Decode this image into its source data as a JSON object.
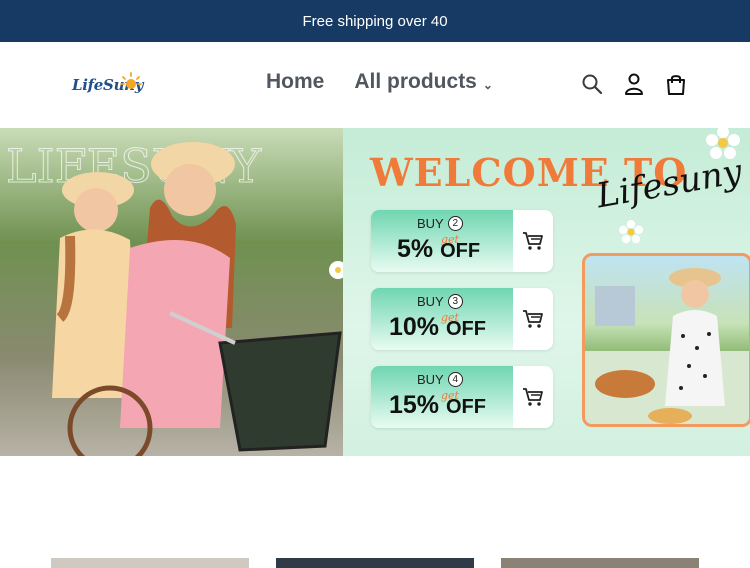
{
  "announcement": {
    "text": "Free shipping over 40"
  },
  "logo": {
    "text": "LifeSuny"
  },
  "nav": {
    "items": [
      {
        "label": "Home"
      },
      {
        "label": "All products"
      }
    ]
  },
  "header_icons": [
    "search-icon",
    "account-icon",
    "cart-icon"
  ],
  "hero": {
    "welcome": "WELCOME TO",
    "script": "Lifesuny",
    "coupons": [
      {
        "buy": "BUY",
        "qty": "2",
        "percent": "5%",
        "off": "OFF",
        "get": "get"
      },
      {
        "buy": "BUY",
        "qty": "3",
        "percent": "10%",
        "off": "OFF",
        "get": "get"
      },
      {
        "buy": "BUY",
        "qty": "4",
        "percent": "15%",
        "off": "OFF",
        "get": "get"
      }
    ]
  },
  "colors": {
    "announcement_bg": "#163a63",
    "nav_text": "#50575f",
    "accent_orange": "#f07a39",
    "coupon_green": "#6fd6b1"
  }
}
